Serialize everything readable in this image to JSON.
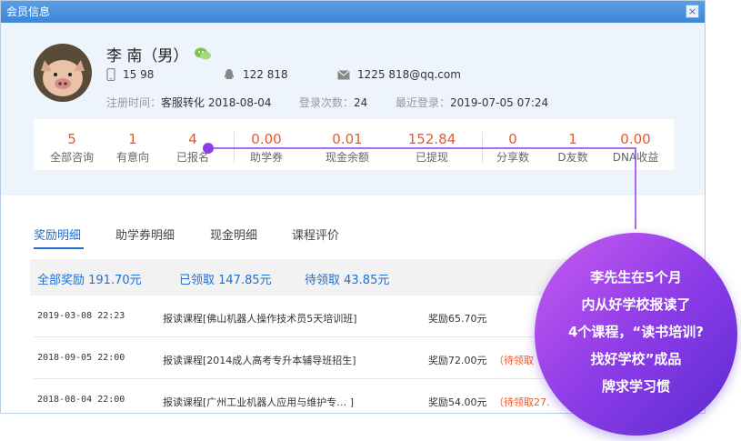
{
  "window": {
    "title": "会员信息",
    "close_label": "×"
  },
  "profile": {
    "name": "李 南（男）",
    "phone": "15 98",
    "qq": "122 818",
    "email": "1225 818@qq.com",
    "register_key": "注册时间：",
    "register_val": "客服转化 2018-08-04",
    "login_key": "登录次数：",
    "login_val": "24",
    "last_key": "最近登录：",
    "last_val": "2019-07-05 07:24"
  },
  "stats": [
    {
      "value": "5",
      "label": "全部咨询"
    },
    {
      "value": "1",
      "label": "有意向"
    },
    {
      "value": "4",
      "label": "已报名"
    },
    {
      "value": "0.00",
      "label": "助学券"
    },
    {
      "value": "0.01",
      "label": "现金余额"
    },
    {
      "value": "152.84",
      "label": "已提现"
    },
    {
      "value": "0",
      "label": "分享数"
    },
    {
      "value": "1",
      "label": "D友数"
    },
    {
      "value": "0.00",
      "label": "DNA收益"
    }
  ],
  "tabs": [
    "奖励明细",
    "助学券明细",
    "现金明细",
    "课程评价"
  ],
  "summary": {
    "total": "全部奖励 191.70元",
    "received": "已领取 147.85元",
    "pending": "待领取 43.85元"
  },
  "rows": [
    {
      "date": "2019-03-08 22:23",
      "desc": "报读课程[佛山机器人操作技术员5天培训班]",
      "reward": "奖励65.70元",
      "pending": ""
    },
    {
      "date": "2018-09-05 22:00",
      "desc": "报读课程[2014成人高考专升本辅导班招生]",
      "reward": "奖励72.00元",
      "pending": "（待领取"
    },
    {
      "date": "2018-08-04 22:00",
      "desc": "报读课程[广州工业机器人应用与维护专…  ]",
      "reward": "奖励54.00元",
      "pending": "（待领取27."
    }
  ],
  "bubble": {
    "lines": [
      "李先生在5个月",
      "内从好学校报读了",
      "4个课程，“读书培训?",
      "找好学校”成品",
      "牌求学习惯"
    ]
  },
  "colors": {
    "accent": "#1e6fd4",
    "highlight": "#e8582a",
    "connector": "#8e3ce8"
  }
}
